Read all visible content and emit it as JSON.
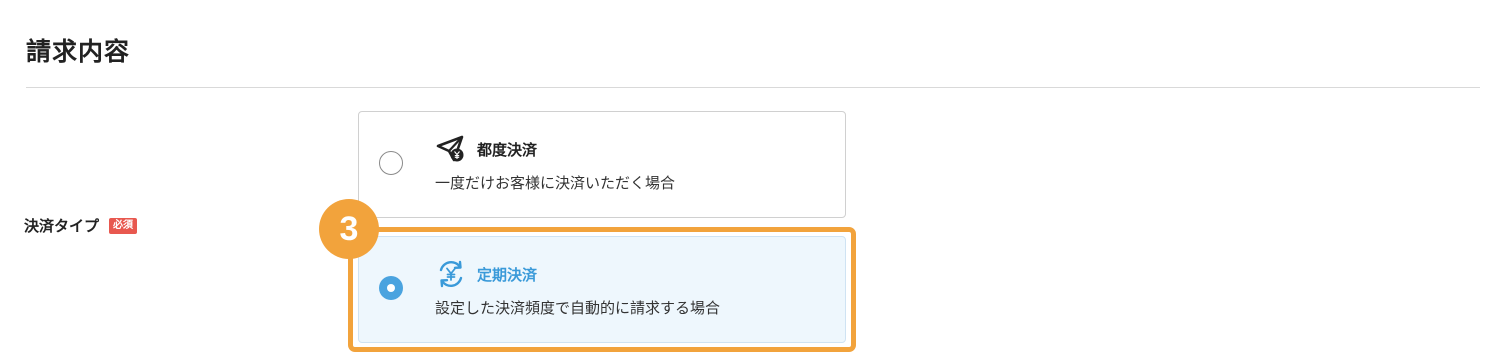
{
  "section": {
    "title": "請求内容"
  },
  "field": {
    "label": "決済タイプ",
    "required_badge": "必須"
  },
  "options": [
    {
      "title": "都度決済",
      "description": "一度だけお客様に決済いただく場合",
      "icon": "send-yen-icon",
      "selected": false
    },
    {
      "title": "定期決済",
      "description": "設定した決済頻度で自動的に請求する場合",
      "icon": "recurring-yen-icon",
      "selected": true
    }
  ],
  "step_badge": {
    "number": "3"
  },
  "colors": {
    "accent_blue": "#4aa3df",
    "highlight_orange": "#f2a33c",
    "required_red": "#e8584f",
    "selected_bg": "#eef7fd"
  }
}
